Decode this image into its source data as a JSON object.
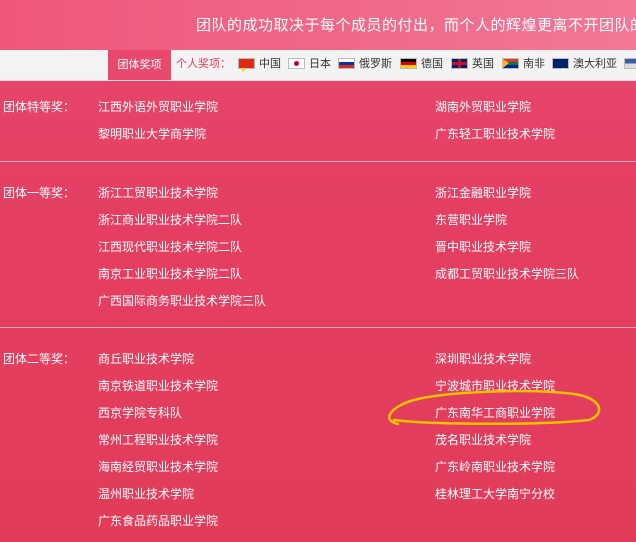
{
  "banner": {
    "text": "团队的成功取决于每个成员的付出，而个人的辉煌更离不开团队的"
  },
  "tabs": {
    "team_label": "团体奖项",
    "personal_label": "个人奖项："
  },
  "countries": [
    {
      "name": "中国",
      "flag": "flag-china-icon"
    },
    {
      "name": "日本",
      "flag": "flag-japan-icon"
    },
    {
      "name": "俄罗斯",
      "flag": "flag-russia-icon"
    },
    {
      "name": "德国",
      "flag": "flag-germany-icon"
    },
    {
      "name": "英国",
      "flag": "flag-uk-icon"
    },
    {
      "name": "南非",
      "flag": "flag-south-africa-icon"
    },
    {
      "name": "澳大利亚",
      "flag": "flag-australia-icon"
    }
  ],
  "groups": {
    "special": {
      "label": "团体特等奖：",
      "left": [
        "江西外语外贸职业学院",
        "黎明职业大学商学院"
      ],
      "right": [
        "湖南外贸职业学院",
        "广东轻工职业技术学院"
      ]
    },
    "first": {
      "label": "团体一等奖：",
      "left": [
        "浙江工贸职业技术学院",
        "浙江商业职业技术学院二队",
        "江西现代职业技术学院二队",
        "南京工业职业技术学院二队",
        "广西国际商务职业技术学院三队"
      ],
      "right": [
        "浙江金融职业学院",
        "东营职业学院",
        "晋中职业技术学院",
        "成都工贸职业技术学院三队"
      ]
    },
    "second": {
      "label": "团体二等奖：",
      "left": [
        "商丘职业技术学院",
        "南京铁道职业技术学院",
        "西京学院专科队",
        "常州工程职业技术学院",
        "海南经贸职业技术学院",
        "温州职业技术学院",
        "广东食品药品职业学院"
      ],
      "right": [
        "深圳职业技术学院",
        "宁波城市职业技术学院",
        "广东南华工商职业学院",
        "茂名职业技术学院",
        "广东岭南职业技术学院",
        "桂林理工大学南宁分校"
      ]
    }
  },
  "colors": {
    "background": "#e43f62",
    "annotation": "#f2c200"
  }
}
